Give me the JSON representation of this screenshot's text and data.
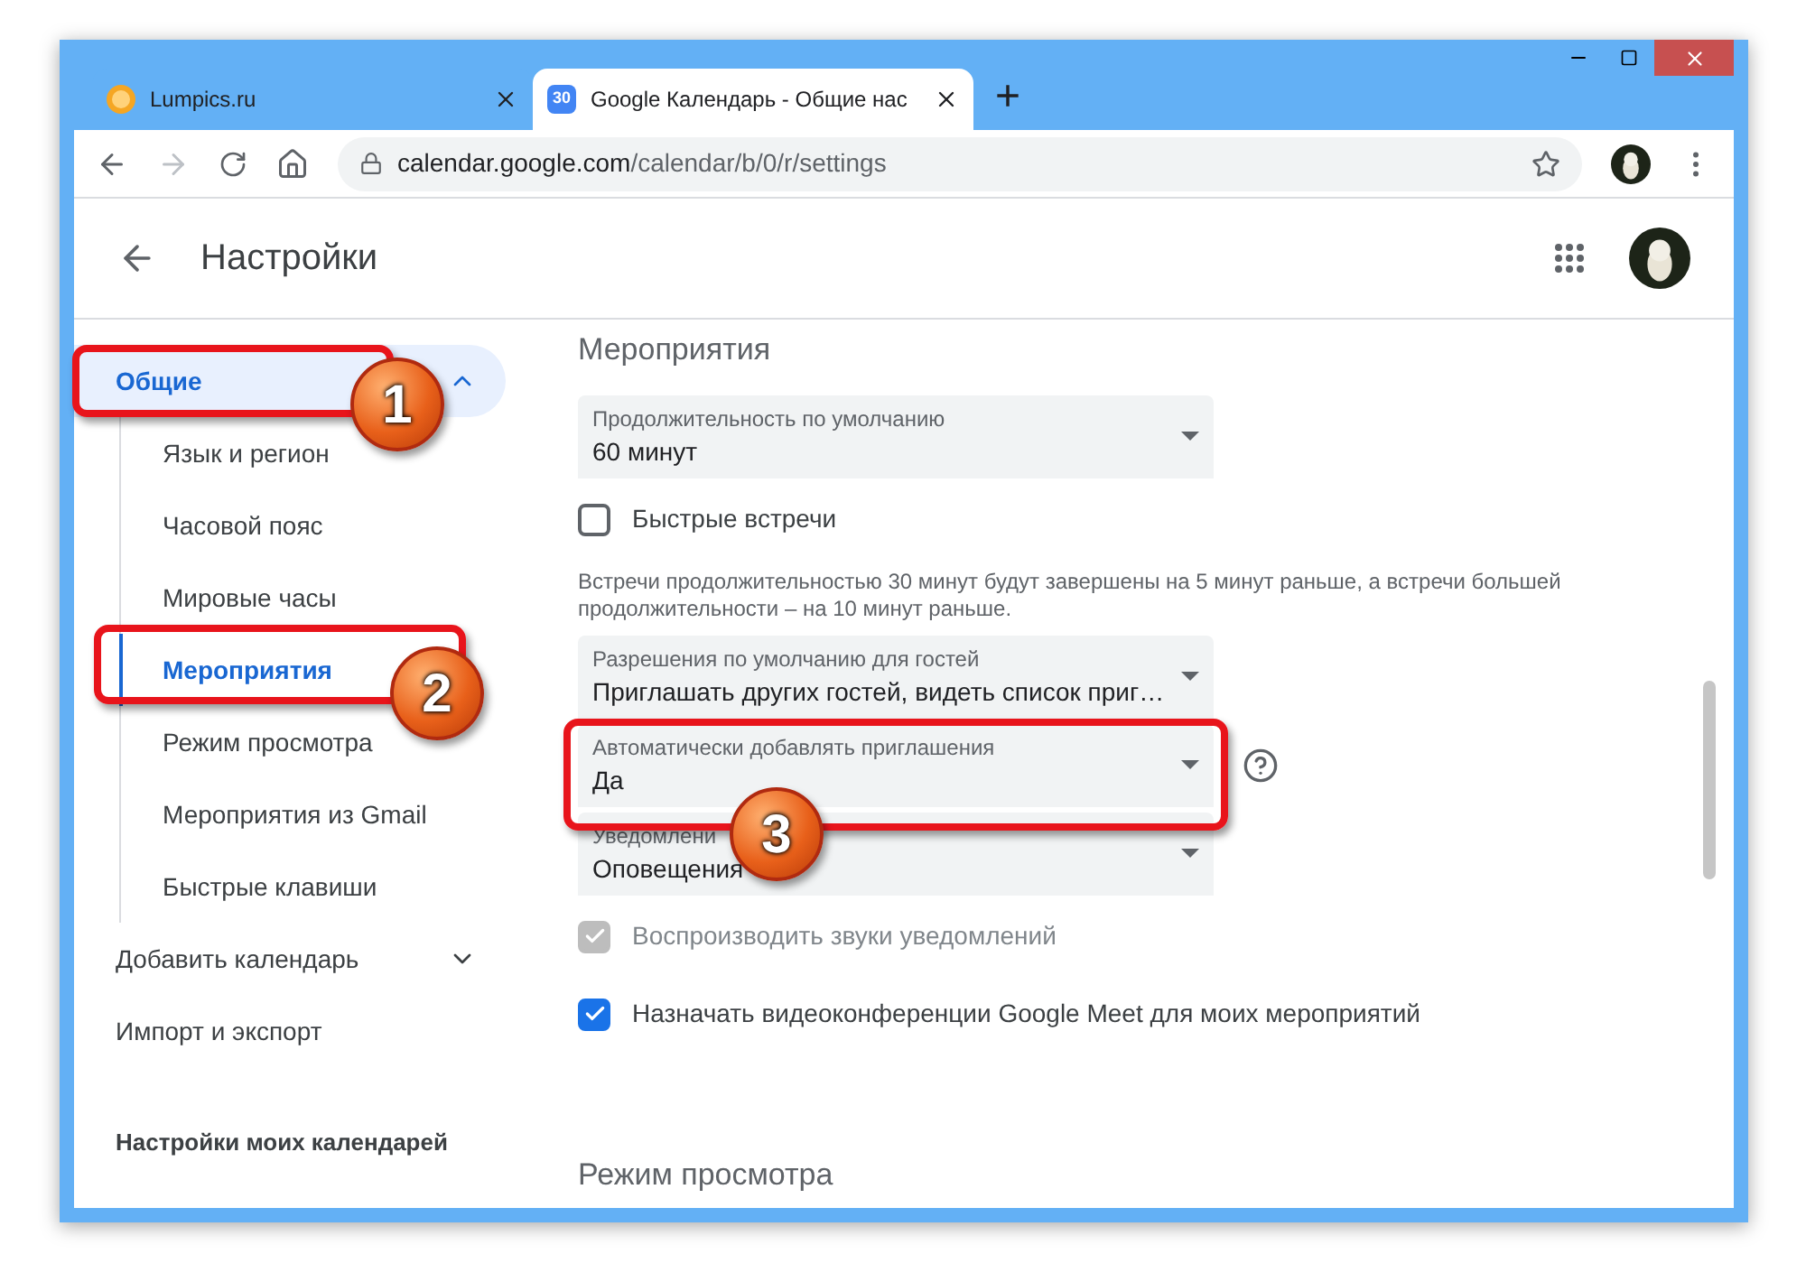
{
  "browser": {
    "tabs": [
      {
        "title": "Lumpics.ru",
        "selected": false,
        "kind": "site"
      },
      {
        "title": "Google Календарь - Общие нас",
        "selected": true,
        "kind": "calendar",
        "favicon_text": "30"
      }
    ],
    "new_tab": "+",
    "url_host": "calendar.google.com",
    "url_path": "/calendar/b/0/r/settings"
  },
  "header": {
    "title": "Настройки"
  },
  "sidebar": {
    "items": [
      {
        "label": "Общие",
        "kind": "expandable",
        "selected": true,
        "expanded": true,
        "children": [
          {
            "label": "Язык и регион",
            "selected": false
          },
          {
            "label": "Часовой пояс",
            "selected": false
          },
          {
            "label": "Мировые часы",
            "selected": false
          },
          {
            "label": "Мероприятия",
            "selected": true
          },
          {
            "label": "Режим просмотра",
            "selected": false
          },
          {
            "label": "Мероприятия из Gmail",
            "selected": false
          },
          {
            "label": "Быстрые клавиши",
            "selected": false
          }
        ]
      },
      {
        "label": "Добавить календарь",
        "kind": "expandable",
        "selected": false,
        "expanded": false
      },
      {
        "label": "Импорт и экспорт",
        "kind": "plain",
        "selected": false
      }
    ],
    "section_heading": "Настройки моих календарей"
  },
  "main": {
    "section_title": "Мероприятия",
    "settings": [
      {
        "kind": "select",
        "label": "Продолжительность по умолчанию",
        "value": "60 минут"
      },
      {
        "kind": "checkbox",
        "label": "Быстрые встречи",
        "checked": false,
        "disabled": false
      },
      {
        "kind": "note",
        "text": "Встречи продолжительностью 30 минут будут завершены на 5 минут раньше, а встречи большей продолжительности – на 10 минут раньше."
      },
      {
        "kind": "select",
        "label": "Разрешения по умолчанию для гостей",
        "value": "Приглашать других гостей, видеть список приг…"
      },
      {
        "kind": "select",
        "label": "Автоматически добавлять приглашения",
        "value": "Да",
        "help": true
      },
      {
        "kind": "select",
        "label": "Уведомлени",
        "value": "Оповещения"
      },
      {
        "kind": "checkbox",
        "label": "Воспроизводить звуки уведомлений",
        "checked": true,
        "disabled": true
      },
      {
        "kind": "checkbox",
        "label": "Назначать видеоконференции Google Meet для моих мероприятий",
        "checked": true,
        "disabled": false
      }
    ],
    "next_section_title": "Режим просмотра"
  },
  "callouts": [
    {
      "number": "1"
    },
    {
      "number": "2"
    },
    {
      "number": "3"
    }
  ]
}
